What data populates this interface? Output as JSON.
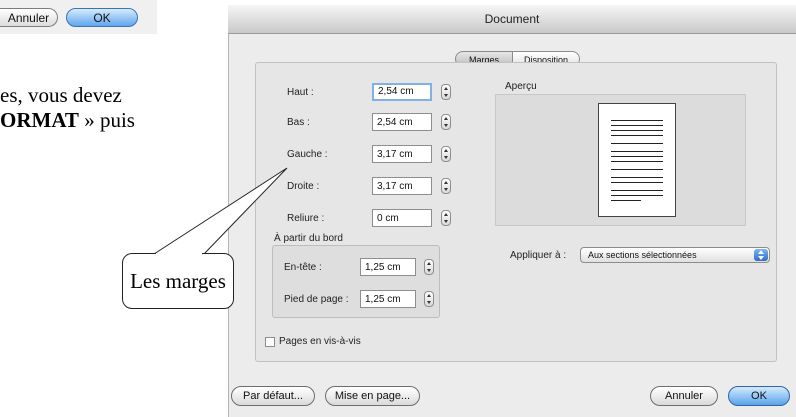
{
  "crop_dialog": {
    "cancel_label": "Annuler",
    "ok_label": "OK"
  },
  "doc_text": {
    "line1": "es, vous devez",
    "line2_bold": "ORMAT",
    "line2_rest": " » puis"
  },
  "callout": {
    "label": "Les marges"
  },
  "dialog": {
    "title": "Document",
    "tabs": [
      {
        "label": "Marges",
        "selected": true
      },
      {
        "label": "Disposition",
        "selected": false
      }
    ],
    "margins": [
      {
        "label": "Haut :",
        "value": "2,54 cm",
        "focused": true
      },
      {
        "label": "Bas :",
        "value": "2,54 cm",
        "focused": false
      },
      {
        "label": "Gauche :",
        "value": "3,17 cm",
        "focused": false
      },
      {
        "label": "Droite :",
        "value": "3,17 cm",
        "focused": false
      },
      {
        "label": "Reliure :",
        "value": "0 cm",
        "focused": false
      }
    ],
    "from_edge": {
      "title": "À partir du bord",
      "fields": [
        {
          "label": "En-tête :",
          "value": "1,25 cm"
        },
        {
          "label": "Pied de page :",
          "value": "1,25 cm"
        }
      ]
    },
    "preview_label": "Aperçu",
    "apply_to": {
      "label": "Appliquer à :",
      "value": "Aux sections sélectionnées"
    },
    "facing_pages": {
      "label": "Pages en vis-à-vis",
      "checked": false
    },
    "buttons": {
      "default_label": "Par défaut...",
      "page_setup_label": "Mise en page...",
      "cancel_label": "Annuler",
      "ok_label": "OK"
    }
  },
  "colors": {
    "default_button": "#5aa2ea",
    "focus_ring": "#7fb0e6",
    "dialog_bg": "#ececec"
  }
}
